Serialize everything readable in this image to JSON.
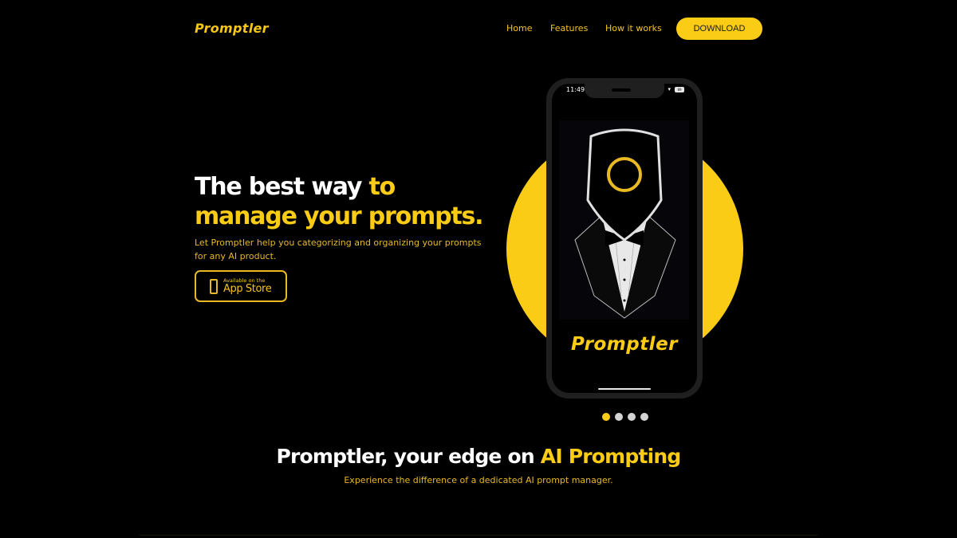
{
  "nav": {
    "logo": "Promptler",
    "links": [
      "Home",
      "Features",
      "How it works"
    ],
    "download_label": "DOWNLOAD"
  },
  "hero": {
    "title_part1": "The best way ",
    "title_part2": "to",
    "title_part3": "manage your prompts.",
    "subtitle": "Let Promptler help you categorizing and organizing your prompts for any AI product.",
    "app_store": {
      "small": "Available on the",
      "big": "App Store",
      "icon": "phone-icon"
    }
  },
  "phone": {
    "status_time": "11:49",
    "battery": "89",
    "screen_logo": "Promptler",
    "artwork": "tuxedo-robot-mascot"
  },
  "carousel": {
    "count": 4,
    "active_index": 0
  },
  "section": {
    "title_white": "Promptler, your edge on ",
    "title_yellow": "AI Prompting",
    "subtitle": "Experience the difference of a dedicated AI prompt manager."
  },
  "colors": {
    "accent": "#facc15",
    "text_accent": "#e8b923",
    "background": "#000000"
  }
}
